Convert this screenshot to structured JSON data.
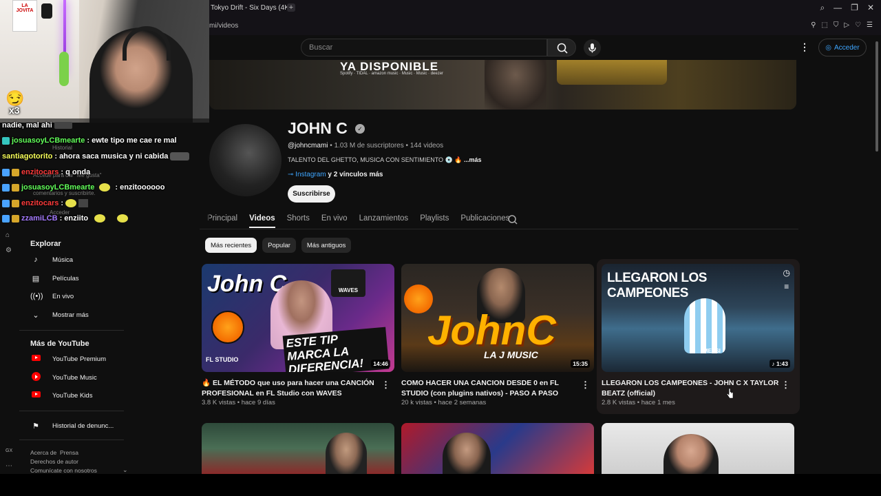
{
  "browser": {
    "tab_title": "Tokyo Drift - Six Days (4K)",
    "url": "mi/videos"
  },
  "header": {
    "search_placeholder": "Buscar",
    "signin_label": "Acceder"
  },
  "banner": {
    "headline": "YA DISPONIBLE",
    "brands": "Spotify · TIDAL · amazon music · Music · Music · deezer"
  },
  "channel": {
    "name": "JOHN C",
    "handle": "@johncmami",
    "subscribers": "1.03 M de suscriptores",
    "videos": "144 videos",
    "description": "TALENTO DEL GHETTO, MUSICA CON SENTIMIENTO",
    "more_label": "...más",
    "link_label": "Instagram",
    "more_links": "y 2 vínculos más",
    "subscribe_label": "Suscribirse"
  },
  "tabs": [
    "Principal",
    "Videos",
    "Shorts",
    "En vivo",
    "Lanzamientos",
    "Playlists",
    "Publicaciones"
  ],
  "chips": [
    "Más recientes",
    "Popular",
    "Más antiguos"
  ],
  "videos": [
    {
      "title": "EL MÉTODO que uso para hacer una CANCIÓN PROFESIONAL en FL Studio con WAVES",
      "meta": "3.8 K vistas • hace 9 días",
      "duration": "14:46",
      "thumb_text": "ESTE TIP MARCA LA DIFERENCIA!",
      "thumb_label_a": "John C",
      "thumb_label_b": "WAVES",
      "thumb_label_c": "FL STUDIO"
    },
    {
      "title": "COMO HACER UNA CANCION DESDE 0 en FL STUDIO (con plugins nativos) - PASO A PASO",
      "meta": "20 k vistas • hace 2 semanas",
      "duration": "15:35",
      "thumb_text": "JohnC",
      "thumb_label_a": "LA J MUSIC"
    },
    {
      "title": "LLEGARON LOS CAMPEONES - JOHN C X TAYLOR BEATZ (official)",
      "meta": "2.8 K vistas • hace 1 mes",
      "duration": "1:43",
      "thumb_text": "LLEGARON LOS CAMPEONES",
      "thumb_label_a": "MESSI"
    }
  ],
  "sidebar": {
    "explore_heading": "Explorar",
    "explore": [
      "Música",
      "Películas",
      "En vivo",
      "Mostrar más"
    ],
    "more_heading": "Más de YouTube",
    "more": [
      "YouTube Premium",
      "YouTube Music",
      "YouTube Kids"
    ],
    "report": "Historial de denunc...",
    "footer": [
      "Acerca de",
      "Prensa",
      "Derechos de autor",
      "Comunícate con nosotros"
    ],
    "ghost_historial": "Historial",
    "ghost_signin_hint": "Accede para dar \"Me gusta\"",
    "ghost_signin_hint2": "comentarios y suscribirte.",
    "ghost_acceder": "Acceder"
  },
  "webcam": {
    "poster": "LA JOVITA",
    "multiplier": "x3"
  },
  "chat": [
    {
      "user": "",
      "text": "nadie, mal ahi"
    },
    {
      "user": "josuasoyLCBmearte",
      "text": ": ewte tipo me cae re mal"
    },
    {
      "user": "santiagotorito",
      "text": ": ahora saca musica y ni cabida"
    },
    {
      "user": "enzitocars",
      "text": ": q onda"
    },
    {
      "user": "josuasoyLCBmearte",
      "text": ": enzitoooooo"
    },
    {
      "user": "enzitocars",
      "text": ":"
    },
    {
      "user": "zzamiLCB",
      "text": ": enziito"
    }
  ],
  "guide_strip": {
    "gx": "GX"
  }
}
